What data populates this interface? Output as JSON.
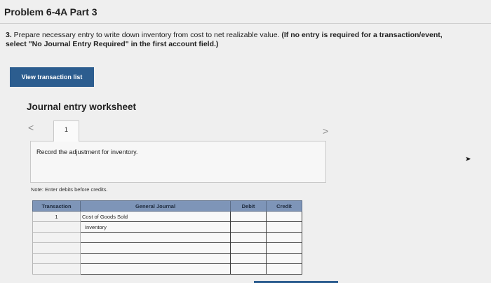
{
  "header": {
    "title": "Problem 6-4A Part 3"
  },
  "instructions": {
    "number": "3.",
    "text": " Prepare necessary entry to write down inventory from cost to net realizable value.",
    "bold_part1": " (If no entry is required for a transaction/event,",
    "bold_part2": "select \"No Journal Entry Required\" in the first account field.)"
  },
  "buttons": {
    "view_transactions": "View transaction list"
  },
  "worksheet": {
    "title": "Journal entry worksheet",
    "prev_icon": "chevron-left",
    "next_icon": "chevron-right",
    "prev_glyph": "<",
    "next_glyph": ">",
    "tab_label": "1",
    "prompt": "Record the adjustment for inventory.",
    "note": "Note: Enter debits before credits."
  },
  "journal_table": {
    "headers": [
      "Transaction",
      "General Journal",
      "Debit",
      "Credit"
    ],
    "rows": [
      {
        "transaction": "1",
        "account": "Cost of Goods Sold",
        "debit": "",
        "credit": ""
      },
      {
        "transaction": "",
        "account": "Inventory",
        "debit": "",
        "credit": ""
      },
      {
        "transaction": "",
        "account": "",
        "debit": "",
        "credit": ""
      },
      {
        "transaction": "",
        "account": "",
        "debit": "",
        "credit": ""
      },
      {
        "transaction": "",
        "account": "",
        "debit": "",
        "credit": ""
      },
      {
        "transaction": "",
        "account": "",
        "debit": "",
        "credit": ""
      }
    ]
  },
  "colors": {
    "button_bg": "#2c5d8f",
    "table_header_bg": "#7e95b8",
    "page_bg": "#efefef"
  }
}
